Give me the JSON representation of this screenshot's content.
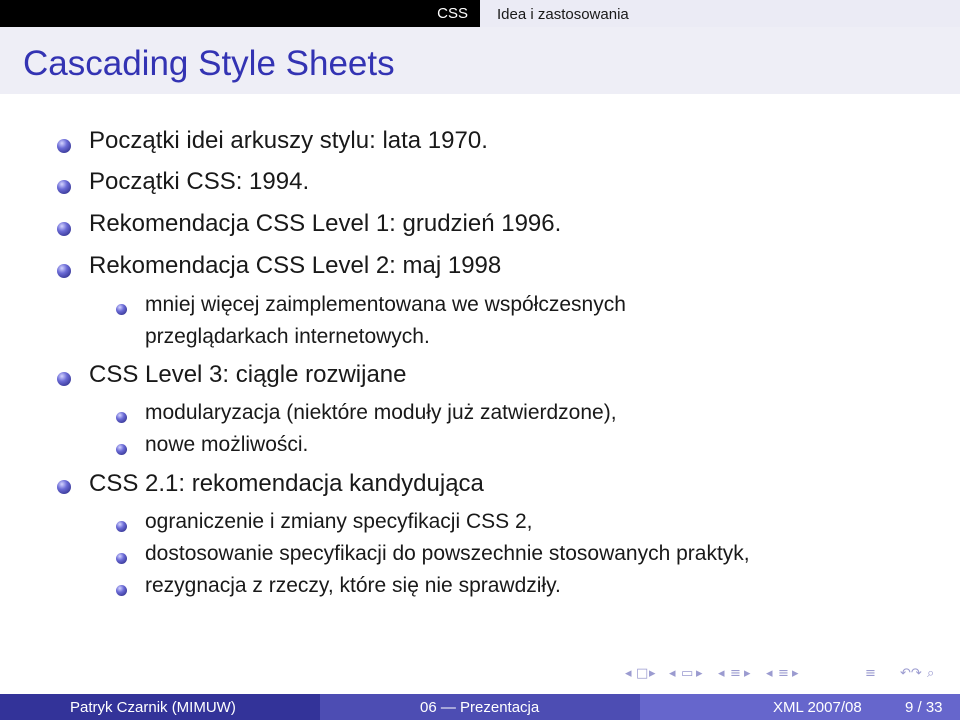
{
  "nav": {
    "section_active": "CSS",
    "section_next": "Idea i zastosowania"
  },
  "title": "Cascading Style Sheets",
  "bullets": [
    {
      "text": "Początki idei arkuszy stylu: lata 1970.",
      "subs": []
    },
    {
      "text": "Początki CSS: 1994.",
      "subs": []
    },
    {
      "text": "Rekomendacja CSS Level 1: grudzień 1996.",
      "subs": []
    },
    {
      "text": "Rekomendacja CSS Level 2: maj 1998",
      "subs": [
        "mniej więcej zaimplementowana we współczesnych",
        "przeglądarkach internetowych."
      ]
    },
    {
      "text": "CSS Level 3: ciągle rozwijane",
      "subs": [
        "modularyzacja (niektóre moduły już zatwierdzone),",
        "nowe możliwości."
      ]
    },
    {
      "text": "CSS 2.1: rekomendacja kandydująca",
      "subs": [
        "ograniczenie i zmiany specyfikacji CSS 2,",
        "dostosowanie specyfikacji do powszechnie stosowanych praktyk,",
        "rezygnacja z rzeczy, które się nie sprawdziły."
      ]
    }
  ],
  "footer": {
    "author": "Patryk Czarnik (MIMUW)",
    "talk": "06 — Prezentacja",
    "course": "XML 2007/08",
    "page": "9 / 33"
  },
  "nav_symbols": {
    "first": "◂",
    "frame": "□",
    "next": "▸",
    "sub_prev": "◂",
    "sub": "▭",
    "sub_next": "▸",
    "sec_prev": "◂",
    "sec": "≡",
    "sec_next": "▸",
    "secsec_prev": "◂",
    "secsec": "≡",
    "secsec_next": "▸",
    "align": "≡",
    "search": "↶↷",
    "zoom": "⌕"
  },
  "colors": {
    "title": "#3333b3",
    "title_bar": "#eeeef6",
    "footer_left": "#333399",
    "footer_mid": "#4d4db3",
    "footer_right": "#6666cc"
  }
}
